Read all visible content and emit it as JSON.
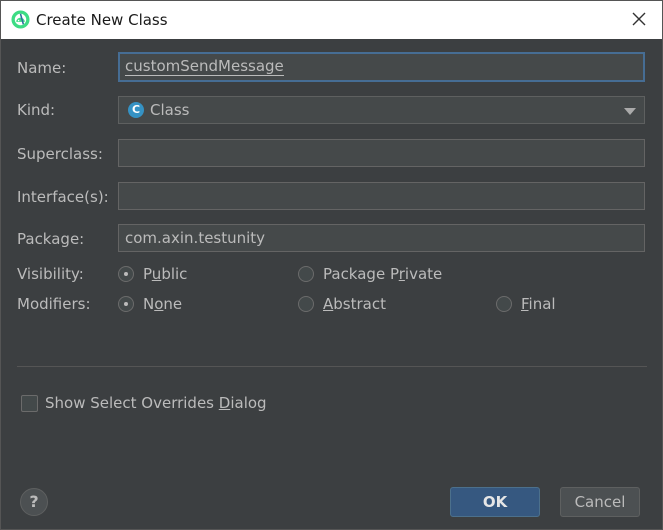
{
  "window": {
    "title": "Create New Class"
  },
  "form": {
    "name": {
      "label": "Name:",
      "value": "customSendMessage"
    },
    "kind": {
      "label": "Kind:",
      "value": "Class",
      "icon": "class-icon"
    },
    "superclass": {
      "label": "Superclass:",
      "value": ""
    },
    "interfaces": {
      "label": "Interface(s):",
      "value": ""
    },
    "package": {
      "label": "Package:",
      "value": "com.axin.testunity"
    },
    "visibility": {
      "label": "Visibility:",
      "public": {
        "pre": "P",
        "u": "u",
        "post": "blic",
        "checked": true
      },
      "package_private": {
        "pre": "Package P",
        "u": "r",
        "post": "ivate",
        "checked": false
      }
    },
    "modifiers": {
      "label": "Modifiers:",
      "none": {
        "pre": "N",
        "u": "o",
        "post": "ne",
        "checked": true
      },
      "abstract": {
        "pre": "",
        "u": "A",
        "post": "bstract",
        "checked": false
      },
      "final": {
        "pre": "",
        "u": "F",
        "post": "inal",
        "checked": false
      }
    },
    "overrides": {
      "pre": "Show Select Overrides ",
      "u": "D",
      "post": "ialog",
      "checked": false
    }
  },
  "buttons": {
    "help": "?",
    "ok": "OK",
    "cancel": "Cancel"
  },
  "colors": {
    "background": "#3c3f41",
    "accent": "#365880",
    "focus": "#466d94",
    "class_icon": "#3592c4",
    "android_green": "#3ddc84"
  }
}
